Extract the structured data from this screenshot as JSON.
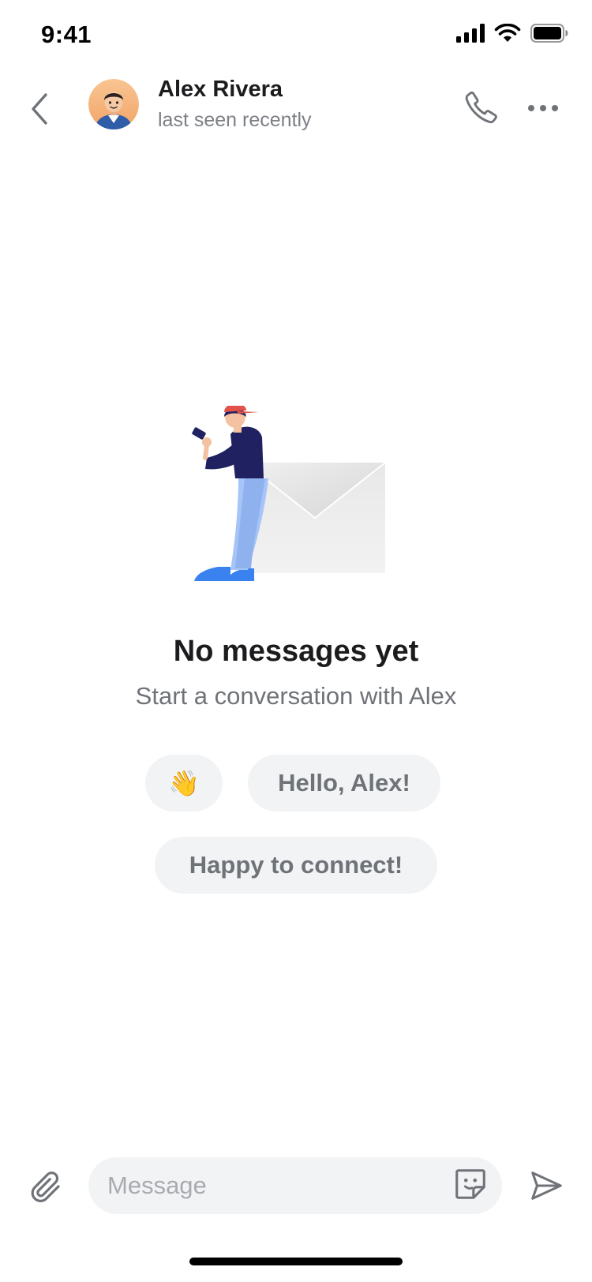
{
  "status_bar": {
    "time": "9:41",
    "icons": [
      "cellular-signal-icon",
      "wifi-icon",
      "battery-icon"
    ]
  },
  "header": {
    "back_icon": "chevron-left-icon",
    "contact_name": "Alex Rivera",
    "contact_status": "last seen recently",
    "call_icon": "phone-icon",
    "more_icon": "ellipsis-icon"
  },
  "empty_state": {
    "illustration": "person-with-phone-and-envelope",
    "title": "No messages yet",
    "subtitle": "Start a conversation with Alex"
  },
  "quick_replies": [
    {
      "label": "👋"
    },
    {
      "label": "Hello, Alex!"
    },
    {
      "label": "Happy to connect!"
    }
  ],
  "composer": {
    "attach_icon": "paperclip-icon",
    "placeholder": "Message",
    "value": "",
    "sticker_icon": "sticker-icon",
    "send_icon": "send-icon"
  },
  "colors": {
    "background": "#ffffff",
    "chip_background": "#f2f3f5",
    "secondary_text": "#6f7378",
    "icon_gray": "#6f7378"
  }
}
